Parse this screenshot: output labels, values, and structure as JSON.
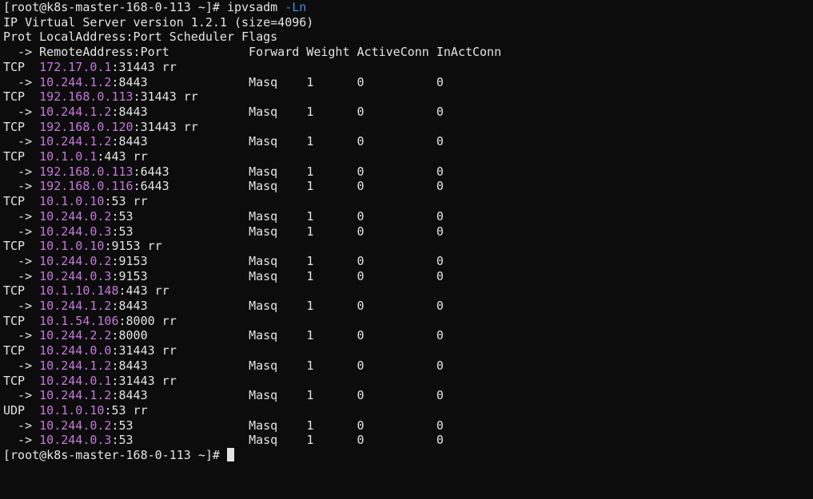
{
  "prompt1": "[root@k8s-master-168-0-113 ~]# ",
  "command": "ipvsadm ",
  "option": "-Ln",
  "version_line": "IP Virtual Server version 1.2.1 (size=4096)",
  "header_line": "Prot LocalAddress:Port Scheduler Flags",
  "sub_header_line": "  -> RemoteAddress:Port           Forward Weight ActiveConn InActConn",
  "services": [
    {
      "p": "TCP  ",
      "ip": "172.17.0.1",
      "pr": ":31443 rr",
      "d": [
        {
          "pre": "  -> ",
          "ip": "10.244.1.2",
          "pr": ":8443",
          "f": "Masq",
          "w": "1",
          "a": "0",
          "i": "0"
        }
      ]
    },
    {
      "p": "TCP  ",
      "ip": "192.168.0.113",
      "pr": ":31443 rr",
      "d": [
        {
          "pre": "  -> ",
          "ip": "10.244.1.2",
          "pr": ":8443",
          "f": "Masq",
          "w": "1",
          "a": "0",
          "i": "0"
        }
      ]
    },
    {
      "p": "TCP  ",
      "ip": "192.168.0.120",
      "pr": ":31443 rr",
      "d": [
        {
          "pre": "  -> ",
          "ip": "10.244.1.2",
          "pr": ":8443",
          "f": "Masq",
          "w": "1",
          "a": "0",
          "i": "0"
        }
      ]
    },
    {
      "p": "TCP  ",
      "ip": "10.1.0.1",
      "pr": ":443 rr",
      "d": [
        {
          "pre": "  -> ",
          "ip": "192.168.0.113",
          "pr": ":6443",
          "f": "Masq",
          "w": "1",
          "a": "0",
          "i": "0"
        },
        {
          "pre": "  -> ",
          "ip": "192.168.0.116",
          "pr": ":6443",
          "f": "Masq",
          "w": "1",
          "a": "0",
          "i": "0"
        }
      ]
    },
    {
      "p": "TCP  ",
      "ip": "10.1.0.10",
      "pr": ":53 rr",
      "d": [
        {
          "pre": "  -> ",
          "ip": "10.244.0.2",
          "pr": ":53",
          "f": "Masq",
          "w": "1",
          "a": "0",
          "i": "0"
        },
        {
          "pre": "  -> ",
          "ip": "10.244.0.3",
          "pr": ":53",
          "f": "Masq",
          "w": "1",
          "a": "0",
          "i": "0"
        }
      ]
    },
    {
      "p": "TCP  ",
      "ip": "10.1.0.10",
      "pr": ":9153 rr",
      "d": [
        {
          "pre": "  -> ",
          "ip": "10.244.0.2",
          "pr": ":9153",
          "f": "Masq",
          "w": "1",
          "a": "0",
          "i": "0"
        },
        {
          "pre": "  -> ",
          "ip": "10.244.0.3",
          "pr": ":9153",
          "f": "Masq",
          "w": "1",
          "a": "0",
          "i": "0"
        }
      ]
    },
    {
      "p": "TCP  ",
      "ip": "10.1.10.148",
      "pr": ":443 rr",
      "d": [
        {
          "pre": "  -> ",
          "ip": "10.244.1.2",
          "pr": ":8443",
          "f": "Masq",
          "w": "1",
          "a": "0",
          "i": "0"
        }
      ]
    },
    {
      "p": "TCP  ",
      "ip": "10.1.54.106",
      "pr": ":8000 rr",
      "d": [
        {
          "pre": "  -> ",
          "ip": "10.244.2.2",
          "pr": ":8000",
          "f": "Masq",
          "w": "1",
          "a": "0",
          "i": "0"
        }
      ]
    },
    {
      "p": "TCP  ",
      "ip": "10.244.0.0",
      "pr": ":31443 rr",
      "d": [
        {
          "pre": "  -> ",
          "ip": "10.244.1.2",
          "pr": ":8443",
          "f": "Masq",
          "w": "1",
          "a": "0",
          "i": "0"
        }
      ]
    },
    {
      "p": "TCP  ",
      "ip": "10.244.0.1",
      "pr": ":31443 rr",
      "d": [
        {
          "pre": "  -> ",
          "ip": "10.244.1.2",
          "pr": ":8443",
          "f": "Masq",
          "w": "1",
          "a": "0",
          "i": "0"
        }
      ]
    },
    {
      "p": "UDP  ",
      "ip": "10.1.0.10",
      "pr": ":53 rr",
      "d": [
        {
          "pre": "  -> ",
          "ip": "10.244.0.2",
          "pr": ":53",
          "f": "Masq",
          "w": "1",
          "a": "0",
          "i": "0"
        },
        {
          "pre": "  -> ",
          "ip": "10.244.0.3",
          "pr": ":53",
          "f": "Masq",
          "w": "1",
          "a": "0",
          "i": "0"
        }
      ]
    }
  ],
  "prompt2": "[root@k8s-master-168-0-113 ~]# "
}
